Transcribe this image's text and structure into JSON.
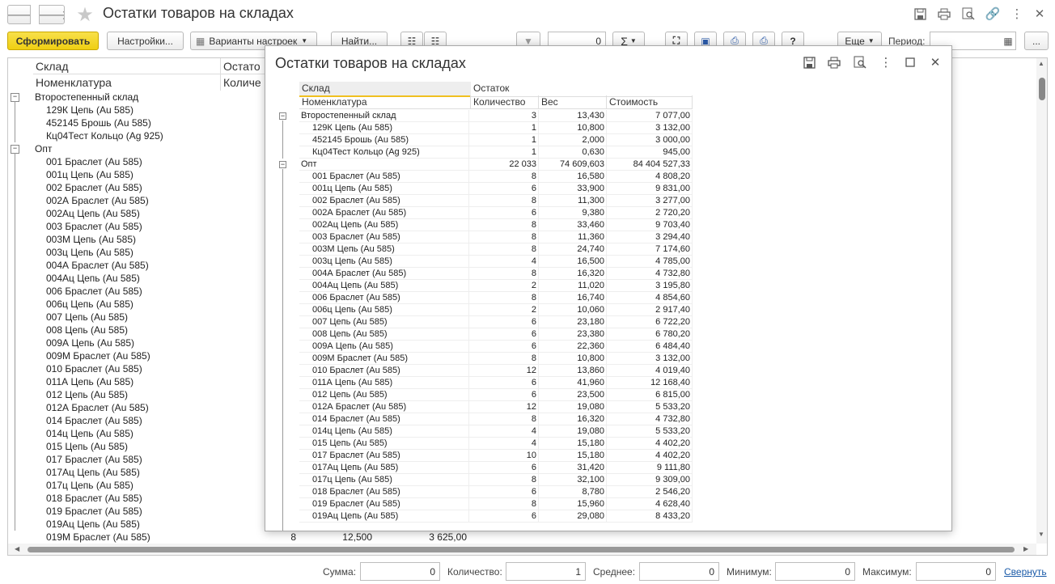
{
  "window": {
    "title": "Остатки товаров на складах"
  },
  "toolbar": {
    "generate_label": "Сформировать",
    "settings_label": "Настройки...",
    "variants_label": "Варианты настроек",
    "find_label": "Найти...",
    "num_field_value": "0",
    "more_label": "Еще",
    "period_label": "Период:"
  },
  "background_report": {
    "header": {
      "col1_row1": "Склад",
      "col1_row2": "Номенклатура",
      "col2_row1": "Остато",
      "col2_row2": "Количе"
    },
    "groups": [
      {
        "name": "Второстепенный склад",
        "items": [
          "129К Цепь (Au 585)",
          "452145 Брошь (Au 585)",
          "Кц04Тест Кольцо (Ag 925)"
        ]
      },
      {
        "name": "Опт",
        "items": [
          "001 Браслет (Au 585)",
          "001ц Цепь (Au 585)",
          "002 Браслет (Au 585)",
          "002А Браслет (Au 585)",
          "002Ац Цепь (Au 585)",
          "003 Браслет (Au 585)",
          "003М Цепь (Au 585)",
          "003ц Цепь (Au 585)",
          "004А Браслет (Au 585)",
          "004Ац Цепь (Au 585)",
          "006 Браслет (Au 585)",
          "006ц Цепь (Au 585)",
          "007 Цепь (Au 585)",
          "008 Цепь (Au 585)",
          "009А Цепь (Au 585)",
          "009М Браслет (Au 585)",
          "010 Браслет (Au 585)",
          "011А Цепь (Au 585)",
          "012 Цепь (Au 585)",
          "012А Браслет (Au 585)",
          "014 Браслет (Au 585)",
          "014ц Цепь (Au 585)",
          "015 Цепь (Au 585)",
          "017 Браслет (Au 585)",
          "017Ац Цепь (Au 585)",
          "017ц Цепь (Au 585)",
          "018 Браслет (Au 585)",
          "019 Браслет (Au 585)",
          "019Ац Цепь (Au 585)"
        ]
      }
    ],
    "last_row": {
      "name": "019М Браслет (Au 585)",
      "qty": "8",
      "weight": "12,500",
      "cost": "3 625,00"
    }
  },
  "modal": {
    "title": "Остатки товаров на складах",
    "header": {
      "sklad": "Склад",
      "ostatok": "Остаток",
      "nomenklatura": "Номенклатура",
      "qty": "Количество",
      "weight": "Вес",
      "cost": "Стоимость"
    },
    "rows": [
      {
        "name": "Второстепенный склад",
        "qty": "3",
        "weight": "13,430",
        "cost": "7 077,00",
        "level": 0
      },
      {
        "name": "129К Цепь (Au 585)",
        "qty": "1",
        "weight": "10,800",
        "cost": "3 132,00",
        "level": 1
      },
      {
        "name": "452145 Брошь (Au 585)",
        "qty": "1",
        "weight": "2,000",
        "cost": "3 000,00",
        "level": 1
      },
      {
        "name": "Кц04Тест Кольцо (Ag 925)",
        "qty": "1",
        "weight": "0,630",
        "cost": "945,00",
        "level": 1
      },
      {
        "name": "Опт",
        "qty": "22 033",
        "weight": "74 609,603",
        "cost": "84 404 527,33",
        "level": 0
      },
      {
        "name": "001 Браслет (Au 585)",
        "qty": "8",
        "weight": "16,580",
        "cost": "4 808,20",
        "level": 1
      },
      {
        "name": "001ц Цепь (Au 585)",
        "qty": "6",
        "weight": "33,900",
        "cost": "9 831,00",
        "level": 1
      },
      {
        "name": "002 Браслет (Au 585)",
        "qty": "8",
        "weight": "11,300",
        "cost": "3 277,00",
        "level": 1
      },
      {
        "name": "002А Браслет (Au 585)",
        "qty": "6",
        "weight": "9,380",
        "cost": "2 720,20",
        "level": 1
      },
      {
        "name": "002Ац Цепь (Au 585)",
        "qty": "8",
        "weight": "33,460",
        "cost": "9 703,40",
        "level": 1
      },
      {
        "name": "003 Браслет (Au 585)",
        "qty": "8",
        "weight": "11,360",
        "cost": "3 294,40",
        "level": 1
      },
      {
        "name": "003М Цепь (Au 585)",
        "qty": "8",
        "weight": "24,740",
        "cost": "7 174,60",
        "level": 1
      },
      {
        "name": "003ц Цепь (Au 585)",
        "qty": "4",
        "weight": "16,500",
        "cost": "4 785,00",
        "level": 1
      },
      {
        "name": "004А Браслет (Au 585)",
        "qty": "8",
        "weight": "16,320",
        "cost": "4 732,80",
        "level": 1
      },
      {
        "name": "004Ац Цепь (Au 585)",
        "qty": "2",
        "weight": "11,020",
        "cost": "3 195,80",
        "level": 1
      },
      {
        "name": "006 Браслет (Au 585)",
        "qty": "8",
        "weight": "16,740",
        "cost": "4 854,60",
        "level": 1
      },
      {
        "name": "006ц Цепь (Au 585)",
        "qty": "2",
        "weight": "10,060",
        "cost": "2 917,40",
        "level": 1
      },
      {
        "name": "007 Цепь (Au 585)",
        "qty": "6",
        "weight": "23,180",
        "cost": "6 722,20",
        "level": 1
      },
      {
        "name": "008 Цепь (Au 585)",
        "qty": "6",
        "weight": "23,380",
        "cost": "6 780,20",
        "level": 1
      },
      {
        "name": "009А Цепь (Au 585)",
        "qty": "6",
        "weight": "22,360",
        "cost": "6 484,40",
        "level": 1
      },
      {
        "name": "009М Браслет (Au 585)",
        "qty": "8",
        "weight": "10,800",
        "cost": "3 132,00",
        "level": 1
      },
      {
        "name": "010 Браслет (Au 585)",
        "qty": "12",
        "weight": "13,860",
        "cost": "4 019,40",
        "level": 1
      },
      {
        "name": "011А Цепь (Au 585)",
        "qty": "6",
        "weight": "41,960",
        "cost": "12 168,40",
        "level": 1
      },
      {
        "name": "012 Цепь (Au 585)",
        "qty": "6",
        "weight": "23,500",
        "cost": "6 815,00",
        "level": 1
      },
      {
        "name": "012А Браслет (Au 585)",
        "qty": "12",
        "weight": "19,080",
        "cost": "5 533,20",
        "level": 1
      },
      {
        "name": "014 Браслет (Au 585)",
        "qty": "8",
        "weight": "16,320",
        "cost": "4 732,80",
        "level": 1
      },
      {
        "name": "014ц Цепь (Au 585)",
        "qty": "4",
        "weight": "19,080",
        "cost": "5 533,20",
        "level": 1
      },
      {
        "name": "015 Цепь (Au 585)",
        "qty": "4",
        "weight": "15,180",
        "cost": "4 402,20",
        "level": 1
      },
      {
        "name": "017 Браслет (Au 585)",
        "qty": "10",
        "weight": "15,180",
        "cost": "4 402,20",
        "level": 1
      },
      {
        "name": "017Ац Цепь (Au 585)",
        "qty": "6",
        "weight": "31,420",
        "cost": "9 111,80",
        "level": 1
      },
      {
        "name": "017ц Цепь (Au 585)",
        "qty": "8",
        "weight": "32,100",
        "cost": "9 309,00",
        "level": 1
      },
      {
        "name": "018 Браслет (Au 585)",
        "qty": "6",
        "weight": "8,780",
        "cost": "2 546,20",
        "level": 1
      },
      {
        "name": "019 Браслет (Au 585)",
        "qty": "8",
        "weight": "15,960",
        "cost": "4 628,40",
        "level": 1
      },
      {
        "name": "019Ац Цепь (Au 585)",
        "qty": "6",
        "weight": "29,080",
        "cost": "8 433,20",
        "level": 1
      }
    ]
  },
  "status_bar": {
    "sum_label": "Сумма:",
    "sum_value": "0",
    "count_label": "Количество:",
    "count_value": "1",
    "avg_label": "Среднее:",
    "avg_value": "0",
    "min_label": "Минимум:",
    "min_value": "0",
    "max_label": "Максимум:",
    "max_value": "0",
    "collapse_link": "Свернуть"
  },
  "colors": {
    "accent_button": "#f2d41d",
    "link": "#1a5aa8"
  }
}
